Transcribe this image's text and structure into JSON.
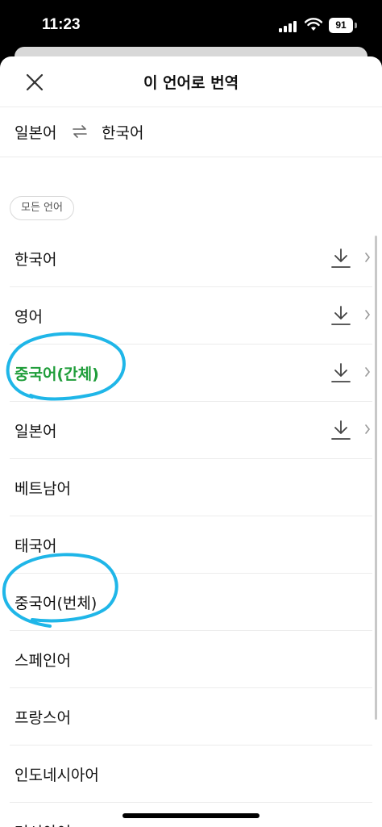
{
  "status_bar": {
    "time": "11:23",
    "battery": "91"
  },
  "header": {
    "title": "이 언어로 번역",
    "close_icon": "close-icon"
  },
  "lang_pair": {
    "source": "일본어",
    "swap_icon": "swap-arrows-icon",
    "target": "한국어"
  },
  "filter": {
    "chip_label": "모든 언어"
  },
  "languages": [
    {
      "label": "한국어",
      "download": true,
      "selected": false
    },
    {
      "label": "영어",
      "download": true,
      "selected": false
    },
    {
      "label": "중국어(간체)",
      "download": true,
      "selected": true
    },
    {
      "label": "일본어",
      "download": true,
      "selected": false
    },
    {
      "label": "베트남어",
      "download": false,
      "selected": false
    },
    {
      "label": "태국어",
      "download": false,
      "selected": false
    },
    {
      "label": "중국어(번체)",
      "download": false,
      "selected": false
    },
    {
      "label": "스페인어",
      "download": false,
      "selected": false
    },
    {
      "label": "프랑스어",
      "download": false,
      "selected": false
    },
    {
      "label": "인도네시아어",
      "download": false,
      "selected": false
    },
    {
      "label": "러시아어",
      "download": false,
      "selected": false
    }
  ],
  "colors": {
    "selected": "#1f9d3a",
    "annotation": "#1fb6e8"
  }
}
